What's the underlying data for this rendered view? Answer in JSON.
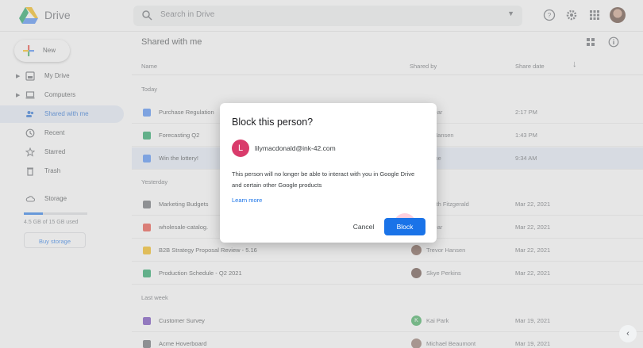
{
  "header": {
    "app_name": "Drive",
    "search_placeholder": "Search in Drive"
  },
  "sidebar": {
    "new_label": "New",
    "items": [
      {
        "label": "My Drive"
      },
      {
        "label": "Computers"
      },
      {
        "label": "Shared with me"
      },
      {
        "label": "Recent"
      },
      {
        "label": "Starred"
      },
      {
        "label": "Trash"
      },
      {
        "label": "Storage"
      }
    ],
    "storage_text": "4.5 GB of 15 GB used",
    "storage_fraction": 0.3,
    "buy_storage": "Buy storage"
  },
  "main": {
    "title": "Shared with me",
    "columns": {
      "name": "Name",
      "shared_by": "Shared by",
      "share_date": "Share date"
    },
    "sections": {
      "today": "Today",
      "yesterday": "Yesterday",
      "last_week": "Last week"
    },
    "rows": [
      {
        "name": "Purchase Regulation",
        "shared_by": "r Bear",
        "date": "2:17 PM",
        "color": "#4285f4"
      },
      {
        "name": "Forecasting Q2",
        "shared_by": "or Hansen",
        "date": "1:43 PM",
        "color": "#0f9d58"
      },
      {
        "name": "Win the lottery!",
        "shared_by": "name",
        "date": "9:34 AM",
        "color": "#4285f4"
      },
      {
        "name": "Marketing Budgets",
        "shared_by": "abeth Fitzgerald",
        "date": "Mar 22, 2021",
        "color": "#5f6368"
      },
      {
        "name": "wholesale-catalog.",
        "shared_by": "r Bear",
        "date": "Mar 22, 2021",
        "color": "#ea4335"
      },
      {
        "name": "B2B Strategy Proposal Review - 5.16",
        "shared_by": "Trevor Hansen",
        "date": "Mar 22, 2021",
        "color": "#f4b400"
      },
      {
        "name": "Production Schedule - Q2 2021",
        "shared_by": "Skye Perkins",
        "date": "Mar 22, 2021",
        "color": "#0f9d58"
      },
      {
        "name": "Customer Survey",
        "shared_by": "Kai Park",
        "date": "Mar 19, 2021",
        "color": "#673ab7"
      },
      {
        "name": "Acme Hoverboard",
        "shared_by": "Michael Beaumont",
        "date": "Mar 19, 2021",
        "color": "#5f6368"
      }
    ]
  },
  "dialog": {
    "title": "Block this person?",
    "avatar_letter": "L",
    "email": "lilymacdonald@ink-42.com",
    "body": "This person will no longer be able to interact with you in Google Drive and certain other Google products",
    "learn_more": "Learn more",
    "cancel": "Cancel",
    "block": "Block"
  },
  "colors": {
    "accent": "#1a73e8",
    "avatar": "#d93b6b"
  }
}
